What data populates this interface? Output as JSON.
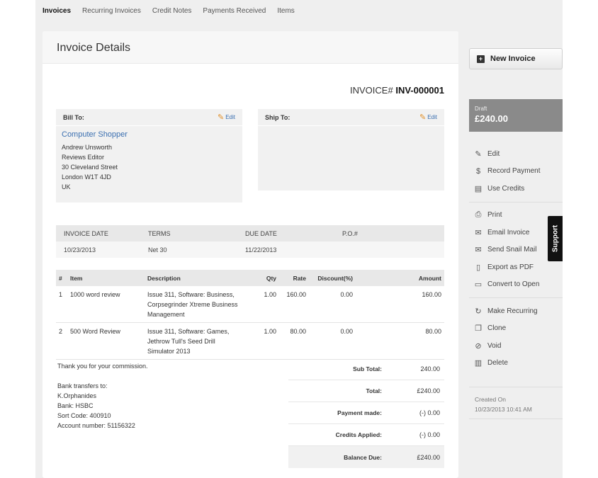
{
  "nav": {
    "tabs": [
      "Invoices",
      "Recurring Invoices",
      "Credit Notes",
      "Payments Received",
      "Items"
    ]
  },
  "panel": {
    "title": "Invoice Details"
  },
  "invoice": {
    "number_label": "INVOICE#",
    "number": "INV-000001"
  },
  "bill_to": {
    "label": "Bill To:",
    "edit_label": "Edit",
    "company": "Computer Shopper",
    "lines": [
      "Andrew Unsworth",
      "Reviews Editor",
      "30 Cleveland Street",
      "London W1T 4JD",
      "UK"
    ]
  },
  "ship_to": {
    "label": "Ship To:",
    "edit_label": "Edit"
  },
  "meta": {
    "headers": [
      "INVOICE DATE",
      "TERMS",
      "DUE DATE",
      "P.O.#"
    ],
    "values": [
      "10/23/2013",
      "Net 30",
      "11/22/2013",
      ""
    ]
  },
  "items": {
    "headers": [
      "#",
      "Item",
      "Description",
      "Qty",
      "Rate",
      "Discount(%)",
      "Amount"
    ],
    "rows": [
      {
        "num": "1",
        "item": "1000 word review",
        "desc_lines": [
          "Issue 311, Software: Business,",
          "Corpsegrinder Xtreme Business",
          "Management"
        ],
        "qty": "1.00",
        "rate": "160.00",
        "discount": "0.00",
        "amount": "160.00"
      },
      {
        "num": "2",
        "item": "500 Word Review",
        "desc_lines": [
          "Issue 311, Software: Games,",
          "Jethrow Tull's Seed Drill",
          "Simulator 2013"
        ],
        "qty": "1.00",
        "rate": "80.00",
        "discount": "0.00",
        "amount": "80.00"
      }
    ]
  },
  "notes": {
    "thanks": "Thank you for your commission.",
    "bank_lines": [
      "Bank transfers to:",
      "K.Orphanides",
      "Bank: HSBC",
      "Sort Code: 400910",
      "Account number: 51156322"
    ]
  },
  "totals": [
    {
      "label": "Sub Total:",
      "value": "240.00"
    },
    {
      "label": "Total:",
      "value": "£240.00"
    },
    {
      "label": "Payment made:",
      "value": "(-) 0.00"
    },
    {
      "label": "Credits Applied:",
      "value": "(-) 0.00"
    },
    {
      "label": "Balance Due:",
      "value": "£240.00"
    }
  ],
  "sidebar": {
    "new_invoice": "New Invoice",
    "status": "Draft",
    "amount": "£240.00",
    "actions_group1": [
      {
        "label": "Edit",
        "icon": "pencil-icon"
      },
      {
        "label": "Record Payment",
        "icon": "payment-icon"
      },
      {
        "label": "Use Credits",
        "icon": "credits-icon"
      }
    ],
    "actions_group2": [
      {
        "label": "Print",
        "icon": "print-icon"
      },
      {
        "label": "Email Invoice",
        "icon": "email-icon"
      },
      {
        "label": "Send Snail Mail",
        "icon": "mail-icon"
      },
      {
        "label": "Export as PDF",
        "icon": "pdf-icon"
      },
      {
        "label": "Convert to Open",
        "icon": "convert-icon"
      }
    ],
    "actions_group3": [
      {
        "label": "Make Recurring",
        "icon": "recurring-icon"
      },
      {
        "label": "Clone",
        "icon": "clone-icon"
      },
      {
        "label": "Void",
        "icon": "void-icon"
      },
      {
        "label": "Delete",
        "icon": "trash-icon"
      }
    ],
    "created_label": "Created On",
    "created_value": "10/23/2013 10:41 AM"
  },
  "support": {
    "label": "Support"
  },
  "colors": {
    "link": "#3a6fb0",
    "status_bg": "#8a8a8a",
    "edit_pencil": "#e0902a"
  }
}
